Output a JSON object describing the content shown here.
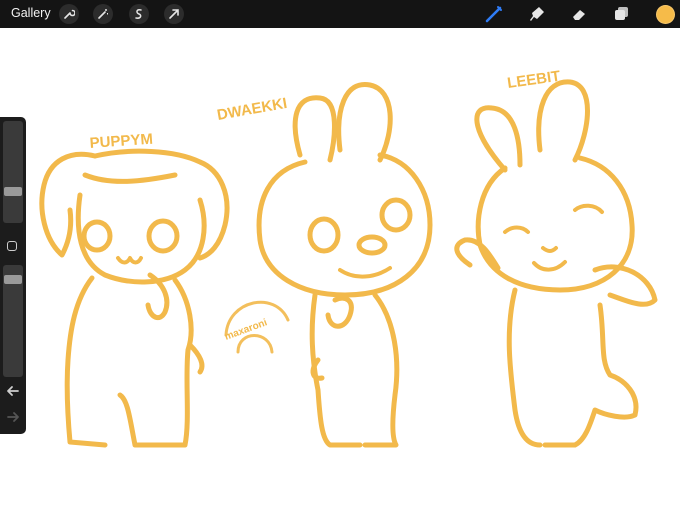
{
  "app": {
    "gallery_label": "Gallery"
  },
  "toolbar": {
    "left_tools": [
      "wrench-icon",
      "magic-wand-icon",
      "selection-icon",
      "transform-arrow-icon"
    ],
    "right_tools": [
      "brush-icon",
      "smudge-icon",
      "eraser-icon",
      "layers-icon"
    ],
    "active_tool": "brush-icon",
    "active_color": "#f6bb49",
    "accent_color": "#2f7cf6"
  },
  "sidebar": {
    "brush_size_level": 0.7,
    "opacity_level": 0.85,
    "buttons": [
      "modify-square-icon",
      "undo-icon",
      "redo-icon"
    ]
  },
  "artwork": {
    "stroke_color": "#f2b94b",
    "labels": {
      "left": "PUPPYM",
      "middle": "DWAEKKI",
      "right": "LEEBIT"
    },
    "watermark": "maxaroni"
  }
}
